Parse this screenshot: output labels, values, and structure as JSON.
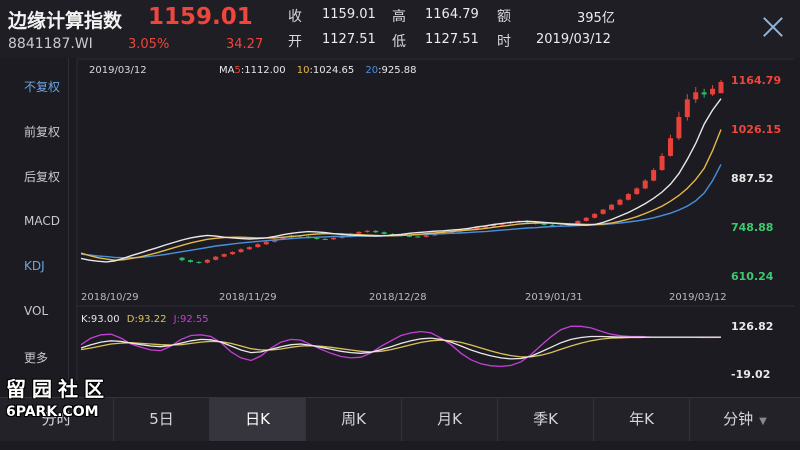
{
  "header": {
    "title": "边缘计算指数",
    "price": "1159.01",
    "code": "8841187.WI",
    "change_pct": "3.05%",
    "change_abs": "34.27",
    "quotes": [
      {
        "label": "收",
        "value": "1159.01"
      },
      {
        "label": "高",
        "value": "1164.79"
      },
      {
        "label": "额",
        "value": "395亿"
      },
      {
        "label": "开",
        "value": "1127.51"
      },
      {
        "label": "低",
        "value": "1127.51"
      },
      {
        "label": "时",
        "value": "2019/03/12"
      }
    ]
  },
  "sidebar": {
    "items": [
      {
        "label": "不复权",
        "active": true
      },
      {
        "label": "前复权",
        "active": false
      },
      {
        "label": "后复权",
        "active": false
      },
      {
        "label": "MACD",
        "active": false
      },
      {
        "label": "KDJ",
        "active": true
      },
      {
        "label": "VOL",
        "active": false
      },
      {
        "label": "更多",
        "active": false
      }
    ]
  },
  "chart": {
    "date_label": "2019/03/12",
    "ma_legend": {
      "ma5_prefix": "MA",
      "ma5_n": "5",
      "ma5_value": ":1112.00",
      "ma10_n": "10",
      "ma10_value": ":1024.65",
      "ma20_n": "20",
      "ma20_value": ":925.88"
    },
    "kdj_legend": {
      "k": "K:93.00",
      "d": "D:93.22",
      "j": "J:92.55"
    },
    "colors": {
      "up": "#e8423a",
      "down": "#2fb866",
      "ma5": "#e8e8e8",
      "ma10": "#e6b84a",
      "ma20": "#4a90d9",
      "k": "#e8e8e8",
      "d": "#d9c25a",
      "j": "#c43fd6",
      "grid": "#2e2d36"
    }
  },
  "chart_data": {
    "type": "candlestick",
    "x_ticks": [
      "2018/10/29",
      "2018/11/29",
      "2018/12/28",
      "2019/01/31",
      "2019/03/12"
    ],
    "y_ticks_price": [
      {
        "value": 1164.79,
        "label": "1164.79",
        "color": "#f0453a"
      },
      {
        "value": 1026.15,
        "label": "1026.15",
        "color": "#f0453a"
      },
      {
        "value": 887.52,
        "label": "887.52",
        "color": "#e8e8e8"
      },
      {
        "value": 748.88,
        "label": "748.88",
        "color": "#3cc86e"
      },
      {
        "value": 610.24,
        "label": "610.24",
        "color": "#3cc86e"
      }
    ],
    "price_range": [
      610.24,
      1164.79
    ],
    "y_ticks_kdj": [
      {
        "value": 126.82,
        "label": "126.82"
      },
      {
        "value": -19.02,
        "label": "-19.02"
      }
    ],
    "kdj_range": [
      -19.02,
      126.82
    ],
    "ma5": [
      660,
      655,
      652,
      650,
      653,
      660,
      668,
      675,
      683,
      690,
      698,
      705,
      712,
      718,
      722,
      725,
      723,
      720,
      718,
      716,
      715,
      716,
      718,
      722,
      727,
      731,
      734,
      736,
      735,
      733,
      730,
      728,
      726,
      725,
      724,
      723,
      724,
      726,
      728,
      731,
      733,
      735,
      737,
      738,
      740,
      742,
      745,
      749,
      752,
      756,
      759,
      762,
      764,
      765,
      764,
      762,
      760,
      758,
      756,
      755,
      754,
      756,
      762,
      770,
      780,
      790,
      802,
      815,
      830,
      848,
      870,
      900,
      940,
      985,
      1040,
      1080,
      1112
    ],
    "ma10": [
      675,
      668,
      662,
      658,
      655,
      656,
      660,
      664,
      670,
      676,
      683,
      690,
      697,
      704,
      709,
      714,
      717,
      719,
      720,
      720,
      719,
      718,
      718,
      718,
      720,
      722,
      724,
      727,
      729,
      730,
      730,
      729,
      728,
      727,
      726,
      725,
      724,
      724,
      725,
      726,
      728,
      730,
      732,
      734,
      736,
      738,
      740,
      742,
      745,
      748,
      751,
      754,
      757,
      759,
      760,
      760,
      760,
      759,
      758,
      757,
      756,
      756,
      757,
      760,
      765,
      771,
      778,
      787,
      797,
      808,
      822,
      838,
      858,
      883,
      915,
      965,
      1024.65
    ],
    "ma20": [
      672,
      670,
      667,
      665,
      663,
      662,
      662,
      663,
      665,
      668,
      671,
      675,
      679,
      683,
      687,
      691,
      695,
      698,
      701,
      704,
      706,
      708,
      710,
      712,
      714,
      716,
      718,
      719,
      720,
      721,
      722,
      722,
      722,
      723,
      723,
      723,
      724,
      724,
      725,
      726,
      727,
      728,
      729,
      730,
      731,
      732,
      733,
      735,
      736,
      738,
      740,
      742,
      744,
      746,
      747,
      749,
      750,
      751,
      752,
      753,
      754,
      755,
      756,
      758,
      760,
      763,
      766,
      770,
      775,
      781,
      788,
      797,
      808,
      823,
      845,
      880,
      925.88
    ],
    "candles": [
      {
        "o": 662,
        "c": 655,
        "h": 664,
        "l": 652
      },
      {
        "o": 655,
        "c": 650,
        "h": 657,
        "l": 648
      },
      {
        "o": 650,
        "c": 648,
        "h": 652,
        "l": 645
      },
      {
        "o": 648,
        "c": 656,
        "h": 658,
        "l": 646
      },
      {
        "o": 656,
        "c": 665,
        "h": 667,
        "l": 654
      },
      {
        "o": 665,
        "c": 672,
        "h": 674,
        "l": 663
      },
      {
        "o": 672,
        "c": 678,
        "h": 680,
        "l": 670
      },
      {
        "o": 678,
        "c": 686,
        "h": 688,
        "l": 676
      },
      {
        "o": 686,
        "c": 692,
        "h": 694,
        "l": 684
      },
      {
        "o": 692,
        "c": 700,
        "h": 703,
        "l": 690
      },
      {
        "o": 700,
        "c": 707,
        "h": 709,
        "l": 698
      },
      {
        "o": 707,
        "c": 714,
        "h": 716,
        "l": 705
      },
      {
        "o": 714,
        "c": 720,
        "h": 722,
        "l": 712
      },
      {
        "o": 720,
        "c": 725,
        "h": 727,
        "l": 718
      },
      {
        "o": 725,
        "c": 722,
        "h": 727,
        "l": 719
      },
      {
        "o": 722,
        "c": 718,
        "h": 724,
        "l": 716
      },
      {
        "o": 718,
        "c": 715,
        "h": 720,
        "l": 713
      },
      {
        "o": 715,
        "c": 714,
        "h": 717,
        "l": 712
      },
      {
        "o": 714,
        "c": 718,
        "h": 720,
        "l": 712
      },
      {
        "o": 718,
        "c": 724,
        "h": 726,
        "l": 716
      },
      {
        "o": 724,
        "c": 730,
        "h": 732,
        "l": 722
      },
      {
        "o": 730,
        "c": 735,
        "h": 737,
        "l": 728
      },
      {
        "o": 735,
        "c": 738,
        "h": 740,
        "l": 733
      },
      {
        "o": 738,
        "c": 734,
        "h": 740,
        "l": 732
      },
      {
        "o": 734,
        "c": 729,
        "h": 736,
        "l": 727
      },
      {
        "o": 729,
        "c": 726,
        "h": 731,
        "l": 724
      },
      {
        "o": 726,
        "c": 724,
        "h": 728,
        "l": 722
      },
      {
        "o": 724,
        "c": 722,
        "h": 726,
        "l": 720
      },
      {
        "o": 722,
        "c": 721,
        "h": 724,
        "l": 719
      },
      {
        "o": 721,
        "c": 725,
        "h": 727,
        "l": 719
      },
      {
        "o": 725,
        "c": 729,
        "h": 731,
        "l": 723
      },
      {
        "o": 729,
        "c": 733,
        "h": 735,
        "l": 727
      },
      {
        "o": 733,
        "c": 736,
        "h": 738,
        "l": 731
      },
      {
        "o": 736,
        "c": 740,
        "h": 742,
        "l": 734
      },
      {
        "o": 740,
        "c": 743,
        "h": 745,
        "l": 738
      },
      {
        "o": 743,
        "c": 747,
        "h": 749,
        "l": 741
      },
      {
        "o": 747,
        "c": 751,
        "h": 753,
        "l": 745
      },
      {
        "o": 751,
        "c": 755,
        "h": 757,
        "l": 749
      },
      {
        "o": 755,
        "c": 759,
        "h": 761,
        "l": 753
      },
      {
        "o": 759,
        "c": 763,
        "h": 765,
        "l": 757
      },
      {
        "o": 763,
        "c": 766,
        "h": 768,
        "l": 761
      },
      {
        "o": 766,
        "c": 762,
        "h": 768,
        "l": 760
      },
      {
        "o": 762,
        "c": 758,
        "h": 764,
        "l": 756
      },
      {
        "o": 758,
        "c": 755,
        "h": 760,
        "l": 753
      },
      {
        "o": 755,
        "c": 753,
        "h": 757,
        "l": 751
      },
      {
        "o": 753,
        "c": 752,
        "h": 755,
        "l": 750
      },
      {
        "o": 752,
        "c": 758,
        "h": 760,
        "l": 750
      },
      {
        "o": 758,
        "c": 766,
        "h": 768,
        "l": 756
      },
      {
        "o": 766,
        "c": 775,
        "h": 777,
        "l": 764
      },
      {
        "o": 775,
        "c": 786,
        "h": 788,
        "l": 773
      },
      {
        "o": 786,
        "c": 798,
        "h": 800,
        "l": 784
      },
      {
        "o": 798,
        "c": 812,
        "h": 814,
        "l": 796
      },
      {
        "o": 812,
        "c": 826,
        "h": 829,
        "l": 810
      },
      {
        "o": 826,
        "c": 842,
        "h": 845,
        "l": 824
      },
      {
        "o": 842,
        "c": 858,
        "h": 861,
        "l": 840
      },
      {
        "o": 858,
        "c": 880,
        "h": 884,
        "l": 856
      },
      {
        "o": 880,
        "c": 910,
        "h": 915,
        "l": 878
      },
      {
        "o": 910,
        "c": 950,
        "h": 958,
        "l": 908
      },
      {
        "o": 950,
        "c": 1000,
        "h": 1010,
        "l": 948
      },
      {
        "o": 1000,
        "c": 1060,
        "h": 1075,
        "l": 995
      },
      {
        "o": 1060,
        "c": 1110,
        "h": 1125,
        "l": 1050
      },
      {
        "o": 1110,
        "c": 1130,
        "h": 1145,
        "l": 1100
      },
      {
        "o": 1130,
        "c": 1124,
        "h": 1140,
        "l": 1115
      },
      {
        "o": 1124,
        "c": 1140,
        "h": 1150,
        "l": 1120
      },
      {
        "o": 1127.51,
        "c": 1159.01,
        "h": 1164.79,
        "l": 1127.51
      }
    ],
    "kdj_k": [
      60,
      70,
      78,
      82,
      80,
      75,
      70,
      66,
      64,
      68,
      75,
      82,
      86,
      85,
      78,
      66,
      54,
      46,
      48,
      56,
      64,
      70,
      72,
      68,
      62,
      56,
      50,
      46,
      44,
      47,
      55,
      64,
      74,
      82,
      88,
      90,
      86,
      78,
      66,
      54,
      44,
      36,
      30,
      27,
      28,
      35,
      48,
      62,
      76,
      86,
      92,
      95,
      95,
      94,
      93,
      93,
      93,
      93,
      93,
      93,
      93,
      93,
      93,
      93,
      93
    ],
    "kdj_d": [
      55,
      60,
      66,
      72,
      75,
      76,
      74,
      72,
      70,
      69,
      70,
      74,
      78,
      80,
      79,
      74,
      66,
      58,
      54,
      54,
      57,
      62,
      66,
      67,
      65,
      62,
      58,
      54,
      50,
      48,
      50,
      55,
      62,
      70,
      77,
      82,
      84,
      82,
      77,
      69,
      60,
      51,
      43,
      37,
      33,
      33,
      38,
      46,
      56,
      66,
      75,
      82,
      87,
      90,
      91,
      92,
      92,
      93,
      93,
      93,
      93,
      93,
      93,
      93,
      93.22
    ],
    "kdj_j": [
      70,
      90,
      100,
      102,
      90,
      72,
      62,
      54,
      52,
      66,
      86,
      98,
      100,
      95,
      76,
      48,
      30,
      22,
      36,
      60,
      78,
      86,
      84,
      70,
      56,
      44,
      34,
      30,
      32,
      45,
      65,
      82,
      98,
      106,
      110,
      106,
      90,
      70,
      44,
      24,
      12,
      6,
      4,
      7,
      18,
      40,
      68,
      94,
      116,
      126,
      126,
      121,
      111,
      102,
      97,
      95,
      95,
      93,
      93,
      93,
      93,
      93,
      92,
      92,
      92.55
    ]
  },
  "tabs": [
    {
      "label": "分时",
      "active": false
    },
    {
      "label": "5日",
      "active": false
    },
    {
      "label": "日K",
      "active": true
    },
    {
      "label": "周K",
      "active": false
    },
    {
      "label": "月K",
      "active": false
    },
    {
      "label": "季K",
      "active": false
    },
    {
      "label": "年K",
      "active": false
    },
    {
      "label": "分钟",
      "active": false
    }
  ],
  "watermark": {
    "cn": "留园社区",
    "en": "6PARK.COM"
  }
}
